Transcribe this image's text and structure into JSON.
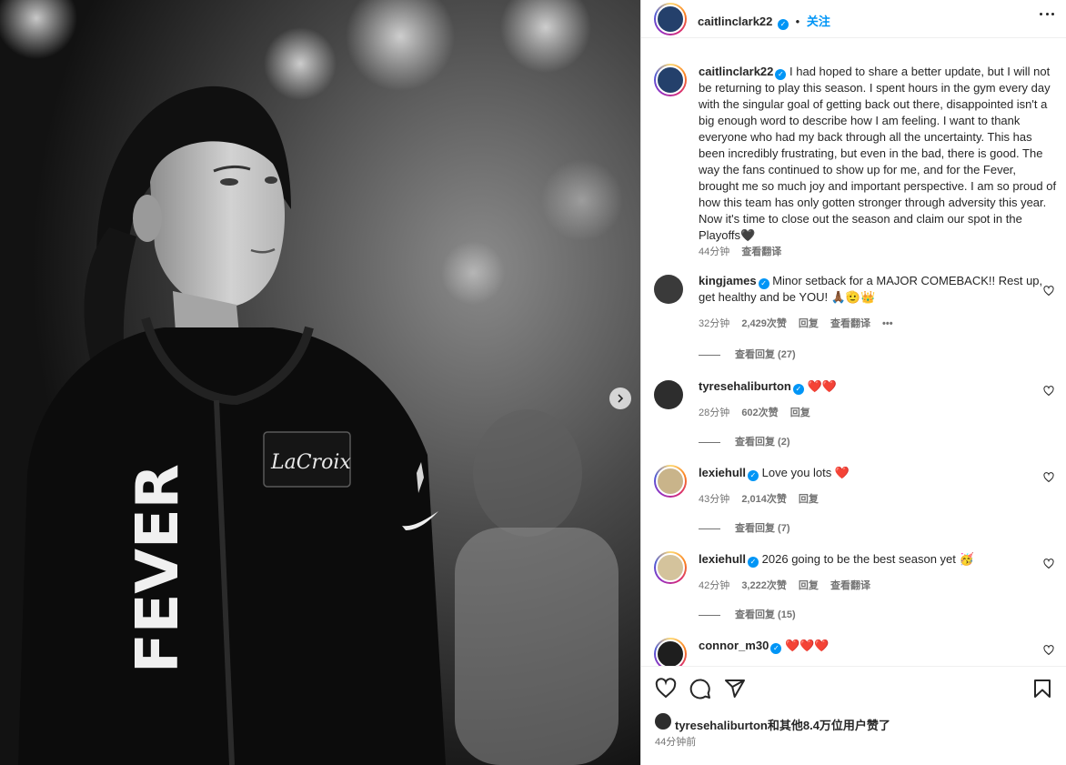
{
  "post": {
    "username": "caitlinclark22",
    "follow_label": "关注",
    "caption": "I had hoped to share a better update, but I will not be returning to play this season. I spent hours in the gym every day with the singular goal of getting back out there, disappointed isn't a big enough word to describe how I am feeling. I want to thank everyone who had my back through all the uncertainty. This has been incredibly frustrating, but even in the bad, there is good. The way the fans continued to show up for me, and for the Fever, brought me so much joy and important perspective. I am so proud of how this team has only gotten stronger through adversity this year. Now it's time to close out the season and claim our spot in the Playoffs🖤",
    "caption_time": "44分钟",
    "caption_translate": "查看翻译",
    "photo_jersey_text": "FEVER",
    "photo_logo_text": "LaCroix"
  },
  "comments": [
    {
      "username": "kingjames",
      "verified": true,
      "text": "Minor setback for a MAJOR COMEBACK!! Rest up, get healthy and be YOU! 🙏🏾🫡👑",
      "time": "32分钟",
      "likes": "2,429次赞",
      "reply": "回复",
      "translate": "查看翻译",
      "replies_label": "查看回复 (27)"
    },
    {
      "username": "tyresehaliburton",
      "verified": true,
      "text": "❤️❤️",
      "time": "28分钟",
      "likes": "602次赞",
      "reply": "回复",
      "translate": "",
      "replies_label": "查看回复 (2)"
    },
    {
      "username": "lexiehull",
      "verified": true,
      "text": "Love you lots ❤️",
      "time": "43分钟",
      "likes": "2,014次赞",
      "reply": "回复",
      "translate": "",
      "replies_label": "查看回复 (7)"
    },
    {
      "username": "lexiehull",
      "verified": true,
      "text": "2026 going to be the best season yet 🥳",
      "time": "42分钟",
      "likes": "3,222次赞",
      "reply": "回复",
      "translate": "查看翻译",
      "replies_label": "查看回复 (15)"
    },
    {
      "username": "connor_m30",
      "verified": true,
      "text": "❤️❤️❤️",
      "time": "",
      "likes": "",
      "reply": "",
      "translate": "",
      "replies_label": ""
    }
  ],
  "footer": {
    "likes_text": "tyresehaliburton和其他8.4万位用户赞了",
    "time": "44分钟前"
  },
  "icons": [
    "more-icon",
    "verified-badge-icon",
    "heart-icon",
    "comment-icon",
    "share-icon",
    "bookmark-icon",
    "chevron-right-icon"
  ]
}
